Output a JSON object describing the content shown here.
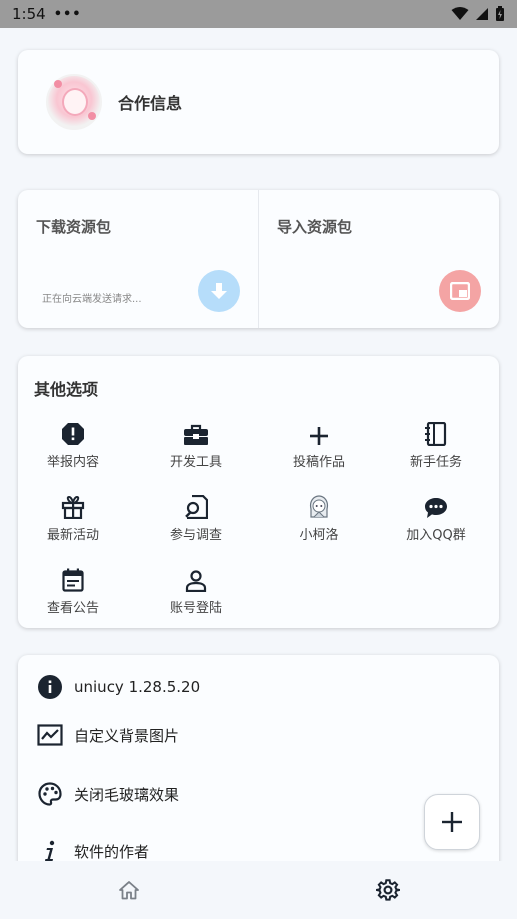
{
  "status_bar": {
    "time": "1:54",
    "dots": "•••"
  },
  "coop": {
    "title": "合作信息"
  },
  "resources": {
    "download": {
      "title": "下载资源包",
      "status": "正在向云端发送请求..."
    },
    "import": {
      "title": "导入资源包"
    }
  },
  "options": {
    "title": "其他选项",
    "items": [
      {
        "label": "举报内容",
        "icon": "report-icon"
      },
      {
        "label": "开发工具",
        "icon": "toolbox-icon"
      },
      {
        "label": "投稿作品",
        "icon": "plus-icon"
      },
      {
        "label": "新手任务",
        "icon": "notebook-icon"
      },
      {
        "label": "最新活动",
        "icon": "gift-icon"
      },
      {
        "label": "参与调查",
        "icon": "survey-icon"
      },
      {
        "label": "小柯洛",
        "icon": "character-icon"
      },
      {
        "label": "加入QQ群",
        "icon": "chat-icon"
      },
      {
        "label": "查看公告",
        "icon": "calendar-icon"
      },
      {
        "label": "账号登陆",
        "icon": "person-icon"
      }
    ]
  },
  "info": {
    "version": "uniucy  1.28.5.20",
    "bg_image": "自定义背景图片",
    "glass": "关闭毛玻璃效果",
    "author": "软件的作者"
  },
  "colors": {
    "download_button": "#b6ddfa",
    "import_button": "#f4a4a4",
    "icon_dark": "#1b2430"
  }
}
